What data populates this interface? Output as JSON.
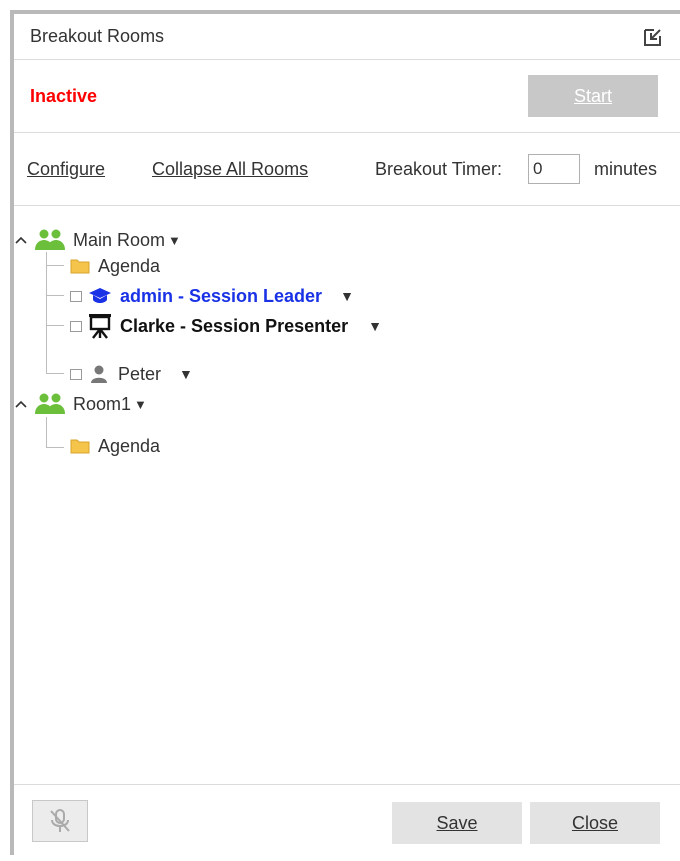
{
  "window": {
    "title": "Breakout Rooms",
    "popout_icon": "popout-icon"
  },
  "status": {
    "text": "Inactive",
    "color": "#ff0000",
    "start_label": "Start",
    "start_disabled": true
  },
  "links": {
    "configure": "Configure",
    "collapse_all": "Collapse All Rooms",
    "timer_label": "Breakout Timer:",
    "timer_value": "0",
    "timer_unit": "minutes"
  },
  "tree": {
    "main_room": {
      "label": "Main Room",
      "agenda": "Agenda",
      "participants": [
        {
          "name": "admin - Session Leader",
          "icon": "graduation-cap-icon",
          "role": "leader"
        },
        {
          "name": "Clarke - Session Presenter",
          "icon": "presenter-easel-icon",
          "role": "presenter"
        },
        {
          "name": "Peter",
          "icon": "user-icon",
          "role": "participant"
        }
      ]
    },
    "room1": {
      "label": "Room1",
      "agenda": "Agenda"
    }
  },
  "footer": {
    "mic_icon": "microphone-muted-icon",
    "save_label": "Save",
    "close_label": "Close"
  },
  "colors": {
    "room_icon": "#6bbf3b",
    "folder_icon": "#f5c44a",
    "leader_text": "#1a32e6",
    "disabled_button": "#c8c8c8"
  }
}
